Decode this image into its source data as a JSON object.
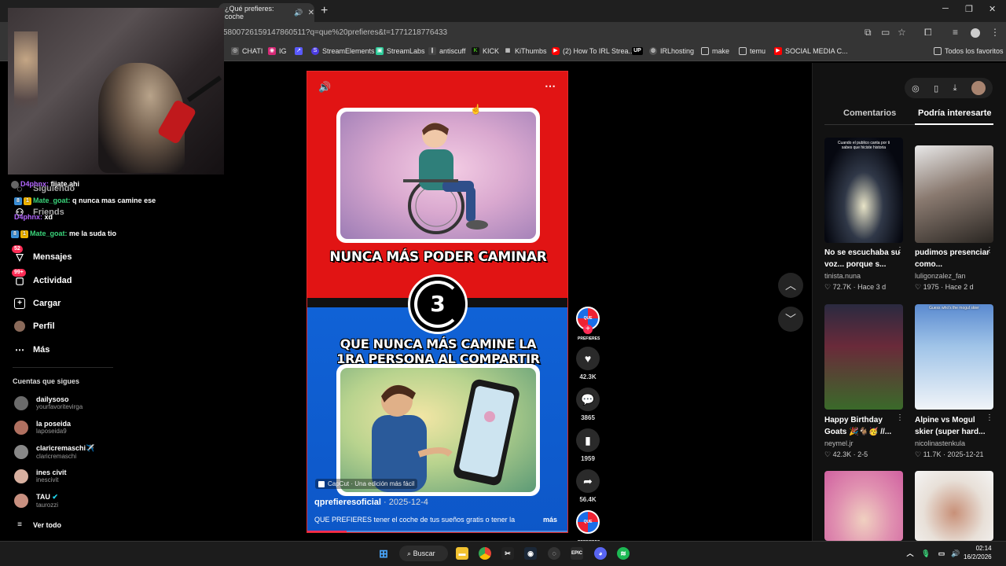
{
  "browser": {
    "active_tab_title": "¿Qué prefieres: coche",
    "url": "5800726159147860511?q=que%20prefieres&t=1771218776433",
    "bookmarks": [
      "CHATI",
      "IG",
      "StreamElements",
      "StreamLabs",
      "antiscuff",
      "KICK",
      "KiThumbs",
      "(2) How To IRL Strea...",
      "IRLhosting",
      "make",
      "temu",
      "SOCIAL MEDIA C..."
    ],
    "bookmarks_right": "Todos los favoritos"
  },
  "chat": [
    {
      "user": "D4phnx:",
      "msg": "fijate ahi"
    },
    {
      "user": "Mate_goat:",
      "msg": "q nunca mas camine ese"
    },
    {
      "user": "D4phnx:",
      "msg": "xd"
    },
    {
      "user": "Mate_goat:",
      "msg": "me la suda tio"
    }
  ],
  "sidebar": {
    "following_label": "Siguiendo",
    "friends_label": "Friends",
    "messages_label": "Mensajes",
    "messages_badge": "52",
    "activity_label": "Actividad",
    "activity_badge": "99+",
    "upload_label": "Cargar",
    "profile_label": "Perfil",
    "more_label": "Más",
    "followed_title": "Cuentas que sigues",
    "followed": [
      {
        "name": "dailysoso",
        "handle": "yourfavoritevirga"
      },
      {
        "name": "la poseida",
        "handle": "laposeida9"
      },
      {
        "name": "claricremaschi✈️",
        "handle": "claricremaschi"
      },
      {
        "name": "ines civit",
        "handle": "inescivit"
      },
      {
        "name": "TAU",
        "handle": "taurozzi"
      }
    ],
    "see_all": "Ver todo"
  },
  "video": {
    "heading_top": "NUNCA MÁS PODER CAMINAR",
    "number": "3",
    "heading_bottom_1": "QUE NUNCA MÁS CAMINE LA",
    "heading_bottom_2": "1RA PERSONA AL COMPARTIR",
    "capcut": "CapCut · Una edición más fácil",
    "author": "qprefieresoficial",
    "date": "· 2025-12-4",
    "description": "QUE PREFIERES tener el coche de tus sueños gratis o tener la",
    "more": "más",
    "progress": 0.15
  },
  "actions": {
    "creator_chip": "QUE PREFIERES",
    "likes": "42.3K",
    "comments": "3865",
    "saves": "1959",
    "shares": "56.4K"
  },
  "right_panel": {
    "tab_comments": "Comentarios",
    "tab_interest": "Podría interesarte",
    "cards": [
      {
        "title": "No se escuchaba su voz... porque s...",
        "user": "tinista.nuna",
        "likes": "72.7K",
        "age": "Hace 3 d",
        "overlay": "Cuando el publico canta por ti sabes que hiciste historia"
      },
      {
        "title": "pudimos presenciar como...",
        "user": "luligonzalez_fan",
        "likes": "1975",
        "age": "Hace 2 d",
        "overlay": ""
      },
      {
        "title": "Happy Birthday Goats 🎉🐐🥳 //...",
        "user": "neymel.jr",
        "likes": "42.3K",
        "age": "2-5",
        "overlay": ""
      },
      {
        "title": "Alpine vs Mogul skier (super hard...",
        "user": "nicolinastenkula",
        "likes": "11.7K",
        "age": "2025-12-21",
        "overlay": "Guess who's the mogul skier"
      },
      {
        "title": "",
        "user": "",
        "likes": "",
        "age": "",
        "overlay": ""
      },
      {
        "title": "",
        "user": "",
        "likes": "",
        "age": "",
        "overlay": ""
      }
    ]
  },
  "taskbar": {
    "search_label": "Buscar",
    "time": "02:14",
    "date": "16/2/2026"
  },
  "colors": {
    "tiktok_red": "#fe2c55",
    "video_red": "#e11414",
    "video_blue": "#1062d6"
  }
}
